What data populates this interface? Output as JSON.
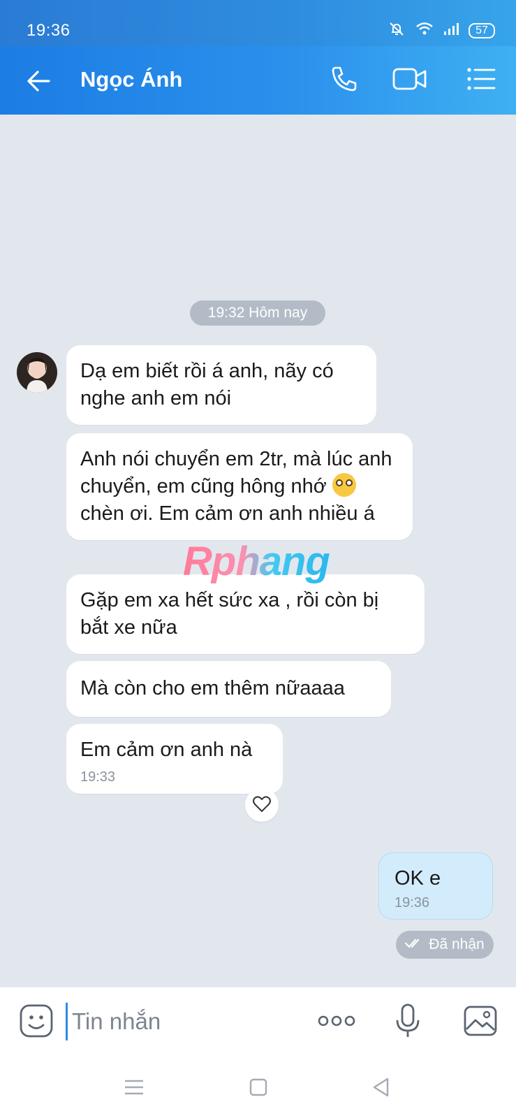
{
  "status_bar": {
    "time": "19:36",
    "battery": "57"
  },
  "header": {
    "contact_name": "Ngọc Ánh"
  },
  "chat": {
    "date_separator": "19:32 Hôm nay",
    "incoming": [
      {
        "text": "Dạ em biết rồi á anh, nãy có nghe anh em nói"
      },
      {
        "text_before_emoji": "Anh nói chuyển em 2tr, mà lúc anh chuyển, em cũng hông nhớ",
        "text_after_emoji": "chèn ơi. Em cảm ơn anh nhiều á"
      },
      {
        "text": "Gặp em xa hết sức xa , rồi còn bị bắt xe nữa"
      },
      {
        "text": "Mà còn cho em thêm nữaaaa"
      },
      {
        "text": "Em cảm ơn anh nà",
        "time": "19:33"
      }
    ],
    "outgoing": {
      "text": "OK e",
      "time": "19:36",
      "status": "Đã nhận"
    },
    "watermark": "Rphang"
  },
  "composer": {
    "placeholder": "Tin nhắn"
  },
  "icons": {
    "back": "arrow-left-icon",
    "call": "phone-icon",
    "video": "video-camera-icon",
    "menu": "list-menu-icon",
    "emoji": "smiley-icon",
    "more": "more-dots-icon",
    "mic": "microphone-icon",
    "gallery": "image-icon",
    "react": "heart-icon"
  },
  "colors": {
    "header": "#2a90ec",
    "chat_bg": "#e2e7ee",
    "outgoing_bubble": "#d3ecfc",
    "pill": "#b3bcc6"
  }
}
